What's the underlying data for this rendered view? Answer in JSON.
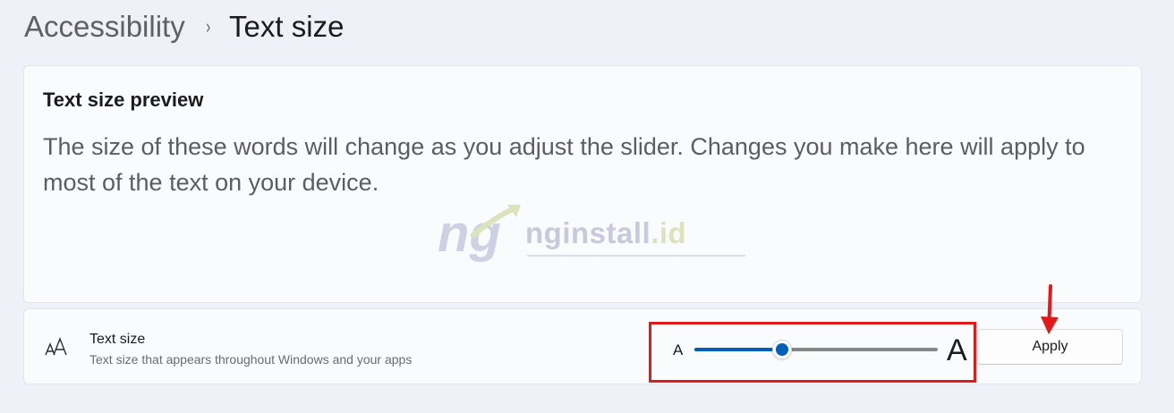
{
  "breadcrumb": {
    "parent": "Accessibility",
    "separator": "›",
    "current": "Text size"
  },
  "preview": {
    "title": "Text size preview",
    "body": "The size of these words will change as you adjust the slider. Changes you make here will apply to most of the text on your device."
  },
  "watermark": {
    "text_main": "nginstall",
    "text_suffix": ".id"
  },
  "setting": {
    "icon": "text-size-icon",
    "title": "Text size",
    "description": "Text size that appears throughout Windows and your apps",
    "slider": {
      "min_label": "A",
      "max_label": "A",
      "value_fraction": 0.36
    },
    "apply_label": "Apply"
  },
  "colors": {
    "accent": "#005fb8",
    "annotation_red": "#e21a1a",
    "background": "#eef1f7",
    "card": "#fafbfd"
  }
}
